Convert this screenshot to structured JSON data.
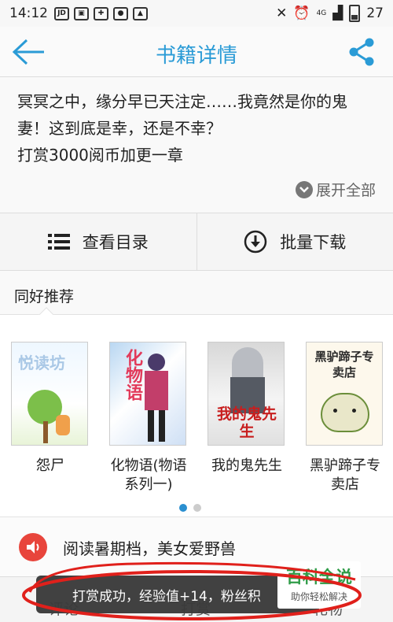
{
  "status": {
    "time": "14:12",
    "battery": "27",
    "network": "4G"
  },
  "header": {
    "title": "书籍详情"
  },
  "desc": {
    "line1": "冥冥之中，缘分早已天注定……我竟然是你的鬼",
    "line2": "妻！这到底是幸，还是不幸？",
    "line3": "打赏3000阅币加更一章",
    "expand": "展开全部"
  },
  "actions": {
    "catalog": "查看目录",
    "download": "批量下载"
  },
  "recommend": {
    "title": "同好推荐",
    "books": [
      {
        "name": "怨尸",
        "cover_text": "悦读坊"
      },
      {
        "name": "化物语(物语系列一)",
        "cover_text": "化物语"
      },
      {
        "name": "我的鬼先生",
        "cover_text": "我的鬼先生"
      },
      {
        "name": "黑驴蹄子专卖店",
        "cover_text": "黑驴蹄子专卖店"
      }
    ],
    "dots": {
      "count": 2,
      "active": 0
    }
  },
  "news": {
    "text": "阅读暑期档，美女爱野兽"
  },
  "tabs": {
    "comment": "评论",
    "reward": "打赏",
    "gift": "礼物"
  },
  "toast": {
    "text": "打赏成功，经验值+14，粉丝积"
  },
  "watermark": {
    "title": "百科全说",
    "subtitle": "助你轻松解决"
  },
  "colors": {
    "accent": "#2a9bd6",
    "annotation": "#e0201b",
    "speaker": "#e8453c"
  }
}
